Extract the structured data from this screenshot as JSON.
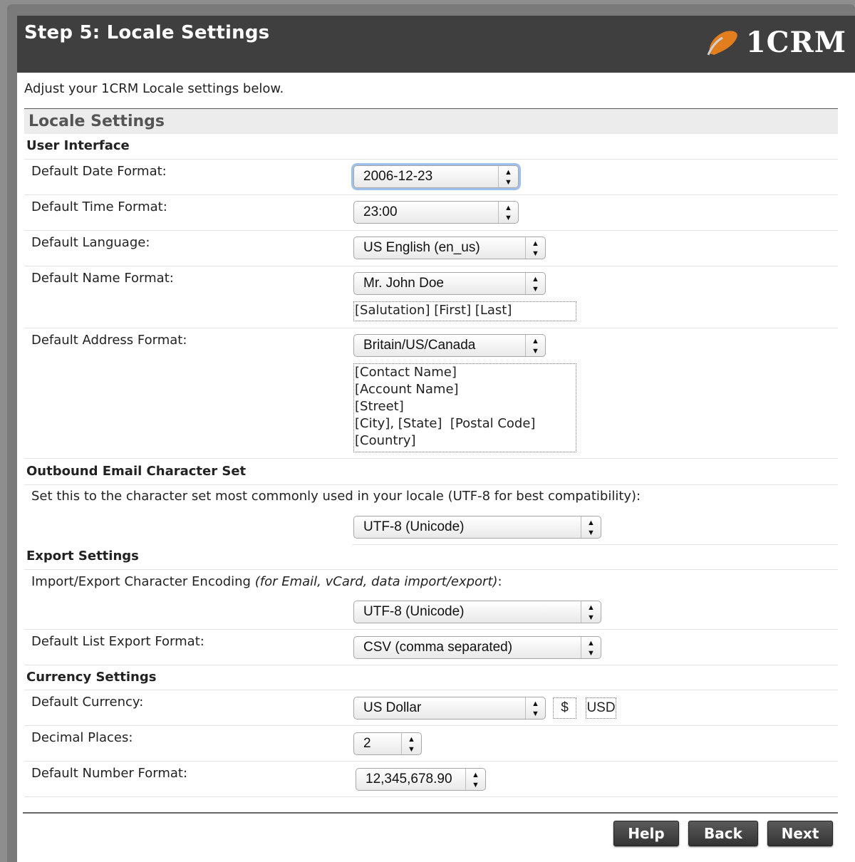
{
  "header": {
    "title": "Step 5: Locale Settings",
    "logo_text": "1CRM"
  },
  "intro": "Adjust your 1CRM Locale settings below.",
  "section_title": "Locale Settings",
  "user_interface": {
    "heading": "User Interface",
    "date_format": {
      "label": "Default Date Format:",
      "value": "2006-12-23"
    },
    "time_format": {
      "label": "Default Time Format:",
      "value": "23:00"
    },
    "language": {
      "label": "Default Language:",
      "value": "US English (en_us)"
    },
    "name_format": {
      "label": "Default Name Format:",
      "value": "Mr. John Doe",
      "preview": "[Salutation] [First] [Last]"
    },
    "address_format": {
      "label": "Default Address Format:",
      "value": "Britain/US/Canada",
      "preview": "[Contact Name]\n[Account Name]\n[Street]\n[City], [State]  [Postal Code]\n[Country]"
    }
  },
  "outbound_email": {
    "heading": "Outbound Email Character Set",
    "description": "Set this to the character set most commonly used in your locale (UTF-8 for best compatibility):",
    "value": "UTF-8 (Unicode)"
  },
  "export_settings": {
    "heading": "Export Settings",
    "encoding_label": "Import/Export Character Encoding ",
    "encoding_note": "(for Email, vCard, data import/export)",
    "encoding_suffix": ":",
    "encoding_value": "UTF-8 (Unicode)",
    "list_export_label": "Default List Export Format:",
    "list_export_value": "CSV (comma separated)"
  },
  "currency_settings": {
    "heading": "Currency Settings",
    "currency_label": "Default Currency:",
    "currency_value": "US Dollar",
    "currency_symbol": "$",
    "currency_code": "USD",
    "decimal_label": "Decimal Places:",
    "decimal_value": "2",
    "number_format_label": "Default Number Format:",
    "number_format_value": "12,345,678.90"
  },
  "buttons": {
    "help": "Help",
    "back": "Back",
    "next": "Next"
  },
  "select_arrows": "▲\n▼"
}
